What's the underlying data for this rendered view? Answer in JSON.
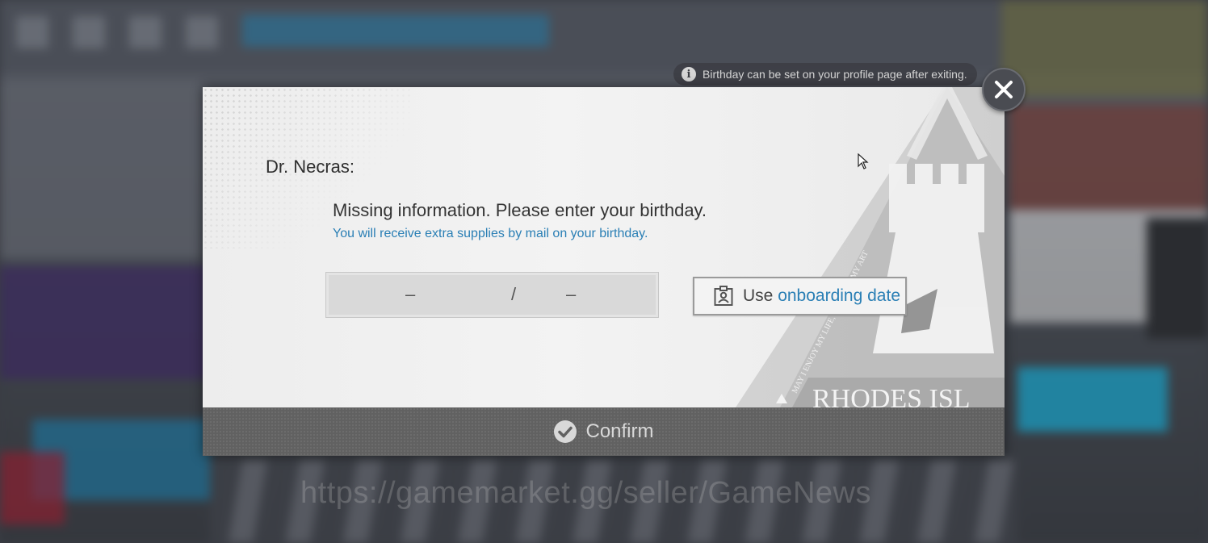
{
  "tooltip": {
    "text": "Birthday can be set on your profile page after exiting."
  },
  "dialog": {
    "greeting": "Dr. Necras:",
    "message": "Missing information. Please enter your birthday.",
    "sub_message": "You will receive extra supplies by mail on your birthday.",
    "birthday_month": "–",
    "birthday_separator": "/",
    "birthday_day": "–",
    "use_button_prefix": "Use",
    "use_button_highlight": "onboarding date",
    "confirm_label": "Confirm",
    "emblem_text": "RHODES ISL",
    "emblem_motto": "MAY I ENJOY MY LIFE, PRACTICE MY ART"
  },
  "watermark": "https://gamemarket.gg/seller/GameNews",
  "colors": {
    "accent_blue": "#2a7fb5",
    "confirm_bar": "#616161"
  },
  "icons": [
    "info-icon",
    "close-icon",
    "id-card-icon",
    "check-icon",
    "cursor-icon"
  ]
}
